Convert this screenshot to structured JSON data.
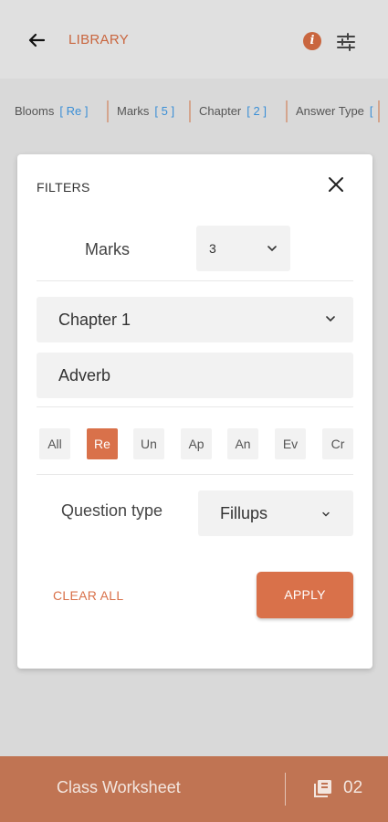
{
  "header": {
    "title": "LIBRARY",
    "back_icon": "arrow-left-icon",
    "info_icon": "info-icon",
    "info_glyph": "i",
    "filter_icon": "tune-icon",
    "accent": "#c9663f"
  },
  "chips": [
    {
      "label": "Blooms",
      "value": "[ Re ]"
    },
    {
      "label": "Marks",
      "value": "[ 5 ]"
    },
    {
      "label": "Chapter",
      "value": "[ 2 ]"
    },
    {
      "label": "Answer Type",
      "value": "["
    }
  ],
  "dialog": {
    "title": "FILTERS",
    "close_icon": "close-icon",
    "marks": {
      "label": "Marks",
      "value": "3"
    },
    "chapter": {
      "value": "Chapter 1"
    },
    "topic": {
      "value": "Adverb"
    },
    "blooms": [
      {
        "label": "All",
        "active": false
      },
      {
        "label": "Re",
        "active": true
      },
      {
        "label": "Un",
        "active": false
      },
      {
        "label": "Ap",
        "active": false
      },
      {
        "label": "An",
        "active": false
      },
      {
        "label": "Ev",
        "active": false
      },
      {
        "label": "Cr",
        "active": false
      }
    ],
    "question_type": {
      "label": "Question type",
      "value": "Fillups"
    },
    "clear_label": "CLEAR ALL",
    "apply_label": "APPLY",
    "button_color": "#d9714a"
  },
  "bottom": {
    "title": "Class Worksheet",
    "count": "02",
    "icon": "book-icon",
    "bg": "#c07453"
  }
}
